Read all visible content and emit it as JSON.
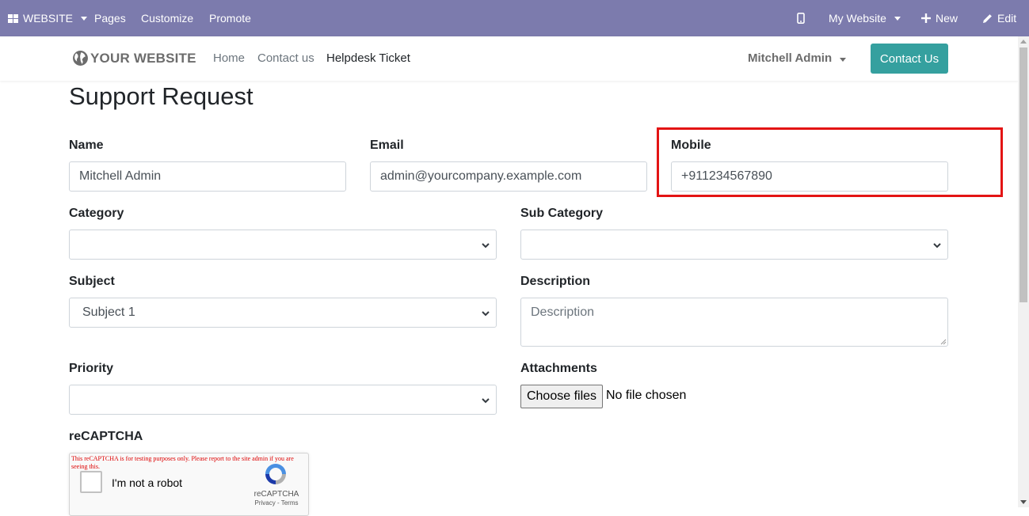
{
  "adminbar": {
    "website_label": "WEBSITE",
    "pages_label": "Pages",
    "customize_label": "Customize",
    "promote_label": "Promote",
    "mobile_icon": "mobile-icon",
    "my_website_label": "My Website",
    "new_label": "New",
    "edit_label": "Edit",
    "bg_color": "#7c7bad"
  },
  "header": {
    "logo_text": "YOUR WEBSITE",
    "nav": [
      "Home",
      "Contact us",
      "Helpdesk Ticket"
    ],
    "user_label": "Mitchell Admin",
    "contact_button": "Contact Us",
    "accent_color": "#35a09f"
  },
  "form": {
    "title": "Support Request",
    "name": {
      "label": "Name",
      "value": "Mitchell Admin"
    },
    "email": {
      "label": "Email",
      "value": "admin@yourcompany.example.com"
    },
    "mobile": {
      "label": "Mobile",
      "value": "+911234567890"
    },
    "category": {
      "label": "Category",
      "value": ""
    },
    "sub_category": {
      "label": "Sub Category",
      "value": ""
    },
    "subject": {
      "label": "Subject",
      "value": "Subject 1"
    },
    "description": {
      "label": "Description",
      "placeholder": "Description"
    },
    "priority": {
      "label": "Priority",
      "value": ""
    },
    "attachments": {
      "label": "Attachments",
      "button": "Choose files",
      "status": "No file chosen"
    },
    "recaptcha": {
      "label": "reCAPTCHA",
      "warning": "This reCAPTCHA is for testing purposes only. Please report to the site admin if you are seeing this.",
      "checkbox_label": "I'm not a robot",
      "brand": "reCAPTCHA",
      "links": "Privacy - Terms"
    }
  },
  "highlight_color": "#e31414"
}
